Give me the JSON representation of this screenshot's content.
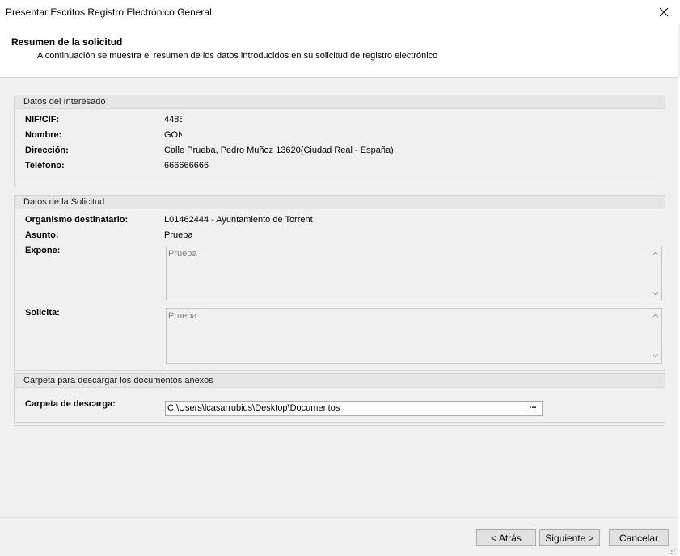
{
  "window": {
    "title": "Presentar Escritos Registro Electrónico General"
  },
  "header": {
    "title": "Resumen de la solicitud",
    "subtitle": "A continuación se muestra el resumen de los datos introducidos en su solicitud de registro electrónico"
  },
  "interesado": {
    "group_title": "Datos del Interesado",
    "fields": [
      {
        "label": "NIF/CIF:",
        "value": "4485"
      },
      {
        "label": "Nombre:",
        "value": "GON"
      },
      {
        "label": "Dirección:",
        "value": "Calle Prueba, Pedro Muñoz 13620(Ciudad Real - España)"
      },
      {
        "label": "Teléfono:",
        "value": "666666666"
      }
    ]
  },
  "solicitud": {
    "group_title": "Datos de la Solicitud",
    "organismo_label": "Organismo destinatario:",
    "organismo_value": "L01462444 - Ayuntamiento de Torrent",
    "asunto_label": "Asunto:",
    "asunto_value": "Prueba",
    "expone_label": "Expone:",
    "expone_value": "Prueba",
    "solicita_label": "Solicita:",
    "solicita_value": "Prueba"
  },
  "carpeta": {
    "group_title": "Carpeta para descargar los documentos anexos",
    "label": "Carpeta de descarga:",
    "path": "C:\\Users\\lcasarrubios\\Desktop\\Documentos",
    "browse_label": "..."
  },
  "footer": {
    "back_label": "< Atrás",
    "next_label": "Siguiente >",
    "cancel_label": "Cancelar"
  },
  "icons": {
    "close": "close-icon",
    "scroll_up": "chevron-up-icon",
    "scroll_down": "chevron-down-icon",
    "resize": "resize-grip-icon"
  }
}
